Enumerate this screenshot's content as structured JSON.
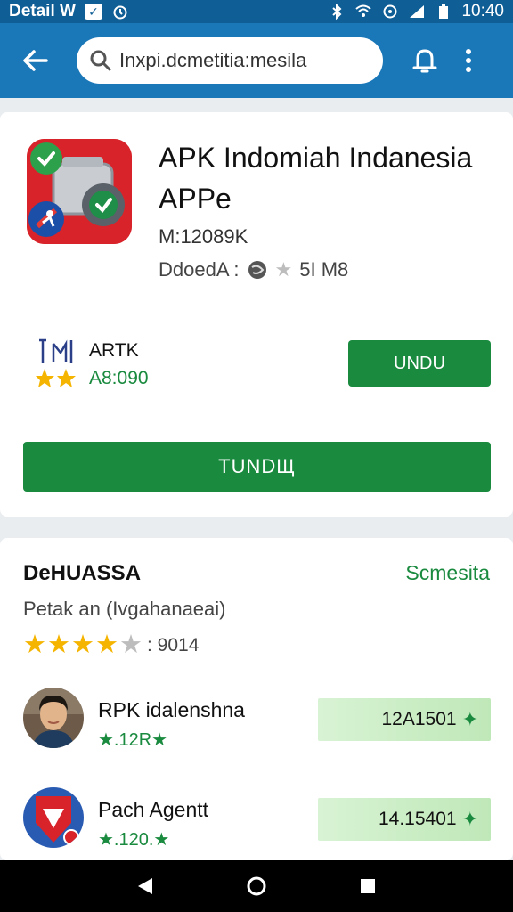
{
  "status_bar": {
    "carrier": "Detail W",
    "time": "10:40"
  },
  "app_bar": {
    "search_value": "Inxpi.dcmetitia:mesila"
  },
  "app": {
    "title": "APK Indomiah Indanesia APPe",
    "version": "M:12089K",
    "meta_label": "DdoedA :",
    "size": "5I M8",
    "promo_title": "ARTK",
    "promo_sub": "A8:090",
    "install_small_label": "UNDU",
    "install_big_label": "TUNDЩ"
  },
  "reviews": {
    "title": "DeHUASSA",
    "see_all": "Scmesita",
    "subtitle": "Petak an (Ivgahanaeai)",
    "rating_value": 4,
    "rating_count": ": 9014",
    "items": [
      {
        "name": "RPK idalenshna",
        "rating_text": "★.12R★",
        "score": "12A1501"
      },
      {
        "name": "Pach Agentt",
        "rating_text": "★.120.★",
        "score": "14.15401"
      }
    ]
  },
  "colors": {
    "app_bar": "#1a77b8",
    "status_bar": "#0f5e96",
    "accent_green": "#1a8a3f",
    "star": "#f4b400"
  },
  "icons": [
    "arrow-left-icon",
    "search-icon",
    "bell-icon",
    "more-vert-icon",
    "back-triangle-icon",
    "home-circle-icon",
    "recents-square-icon"
  ]
}
